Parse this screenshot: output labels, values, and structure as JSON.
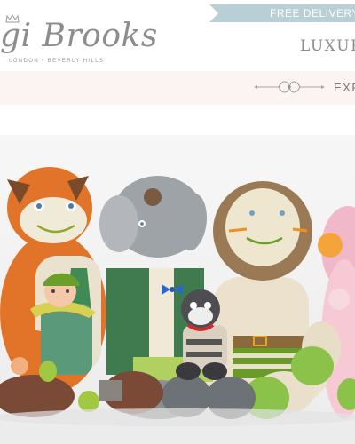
{
  "header": {
    "logo": {
      "text": "gi Brooks",
      "tagline": "LONDON • BEVERLY HILLS"
    },
    "promo": {
      "text": "FREE DELIVERY"
    },
    "nav_item": "LUXUR"
  },
  "subnav": {
    "link": "EXP"
  },
  "hero": {
    "image_description_icon": "plush-toys-icon"
  },
  "colors": {
    "promo_bg": "#b9cfd6",
    "subbar_bg": "#fbf4f3",
    "text_gray": "#8d8d8d"
  }
}
